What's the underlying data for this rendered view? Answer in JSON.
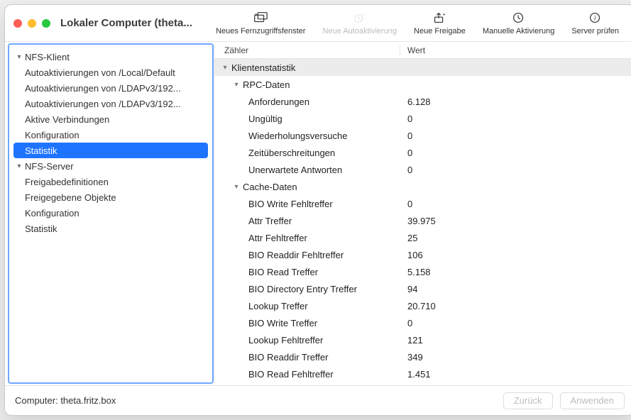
{
  "window": {
    "title": "Lokaler Computer (theta..."
  },
  "toolbar": [
    {
      "id": "remote",
      "label": "Neues Fernzugriffsfenster",
      "disabled": false
    },
    {
      "id": "autoact",
      "label": "Neue Autoaktivierung",
      "disabled": true
    },
    {
      "id": "share",
      "label": "Neue Freigabe",
      "disabled": false
    },
    {
      "id": "manual",
      "label": "Manuelle Aktivierung",
      "disabled": false
    },
    {
      "id": "check",
      "label": "Server prüfen",
      "disabled": false
    }
  ],
  "sidebar": [
    {
      "label": "NFS-Klient",
      "level": 0,
      "expanded": true
    },
    {
      "label": "Autoaktivierungen von /Local/Default",
      "level": 1
    },
    {
      "label": "Autoaktivierungen von /LDAPv3/192...",
      "level": 1
    },
    {
      "label": "Autoaktivierungen von /LDAPv3/192...",
      "level": 1
    },
    {
      "label": "Aktive Verbindungen",
      "level": 1
    },
    {
      "label": "Konfiguration",
      "level": 1
    },
    {
      "label": "Statistik",
      "level": 1,
      "selected": true
    },
    {
      "label": "NFS-Server",
      "level": 0,
      "expanded": true
    },
    {
      "label": "Freigabedefinitionen",
      "level": 1
    },
    {
      "label": "Freigegebene Objekte",
      "level": 1
    },
    {
      "label": "Konfiguration",
      "level": 1
    },
    {
      "label": "Statistik",
      "level": 1
    }
  ],
  "table": {
    "headers": {
      "counter": "Zähler",
      "value": "Wert"
    },
    "rows": [
      {
        "kind": "group0",
        "label": "Klientenstatistik"
      },
      {
        "kind": "group1",
        "label": "RPC-Daten"
      },
      {
        "kind": "data",
        "label": "Anforderungen",
        "value": "6.128"
      },
      {
        "kind": "data",
        "label": "Ungültig",
        "value": "0"
      },
      {
        "kind": "data",
        "label": "Wiederholungsversuche",
        "value": "0"
      },
      {
        "kind": "data",
        "label": "Zeitüberschreitungen",
        "value": "0"
      },
      {
        "kind": "data",
        "label": "Unerwartete Antworten",
        "value": "0"
      },
      {
        "kind": "group1",
        "label": "Cache-Daten"
      },
      {
        "kind": "data",
        "label": "BIO Write Fehltreffer",
        "value": "0"
      },
      {
        "kind": "data",
        "label": "Attr Treffer",
        "value": "39.975"
      },
      {
        "kind": "data",
        "label": "Attr Fehltreffer",
        "value": "25"
      },
      {
        "kind": "data",
        "label": "BIO Readdir Fehltreffer",
        "value": "106"
      },
      {
        "kind": "data",
        "label": "BIO Read Treffer",
        "value": "5.158"
      },
      {
        "kind": "data",
        "label": "BIO Directory Entry Treffer",
        "value": "94"
      },
      {
        "kind": "data",
        "label": "Lookup Treffer",
        "value": "20.710"
      },
      {
        "kind": "data",
        "label": "BIO Write Treffer",
        "value": "0"
      },
      {
        "kind": "data",
        "label": "Lookup Fehltreffer",
        "value": "121"
      },
      {
        "kind": "data",
        "label": "BIO Readdir Treffer",
        "value": "349"
      },
      {
        "kind": "data",
        "label": "BIO Read Fehltreffer",
        "value": "1.451"
      }
    ]
  },
  "footer": {
    "computer_prefix": "Computer: ",
    "computer": "theta.fritz.box",
    "back": "Zurück",
    "apply": "Anwenden"
  }
}
